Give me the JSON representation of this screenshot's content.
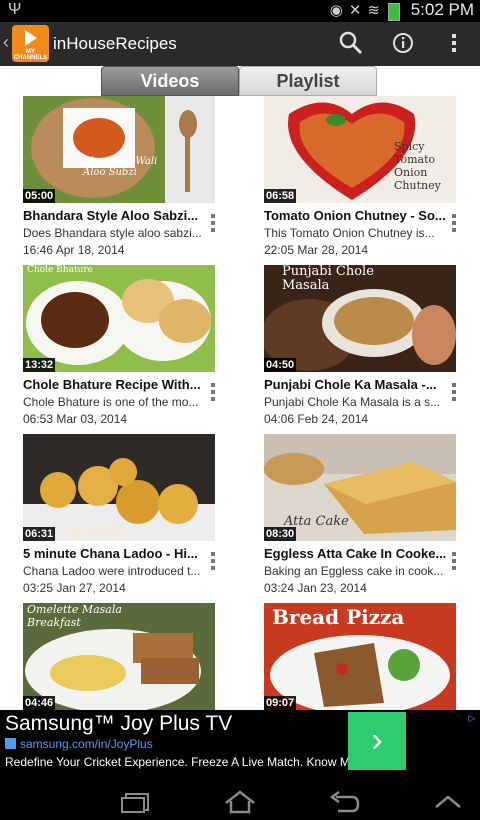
{
  "status_bar": {
    "time": "5:02 PM"
  },
  "app": {
    "title": "inHouseRecipes",
    "logo_label": "MY CHANNELS"
  },
  "tabs": [
    {
      "label": "Videos",
      "active": true
    },
    {
      "label": "Playlist",
      "active": false
    }
  ],
  "icons": {
    "search": "search-icon",
    "info": "info-icon",
    "overflow": "overflow-menu-icon",
    "back": "back-icon",
    "home": "home-icon",
    "recent": "recent-apps-icon",
    "up": "chevron-up-icon"
  },
  "videos": [
    {
      "title": "Bhandara Style Aloo Sabzi...",
      "description": "Does Bhandara style aloo sabzi...",
      "date": "16:46 Apr 18, 2014",
      "duration": "05:00",
      "thumb_caption": "Bhandara Wali Aloo Subzi"
    },
    {
      "title": "Tomato Onion Chutney - So...",
      "description": "This Tomato Onion Chutney is...",
      "date": "22:05 Mar 28, 2014",
      "duration": "06:58",
      "thumb_caption": "Spicy Tomato Onion Chutney"
    },
    {
      "title": "Chole Bhature Recipe With...",
      "description": "Chole Bhature is one of the mo...",
      "date": "06:53 Mar 03, 2014",
      "duration": "13:32",
      "thumb_caption": "Chole Bhature"
    },
    {
      "title": "Punjabi Chole Ka Masala -...",
      "description": "Punjabi Chole Ka Masala is a s...",
      "date": "04:06 Feb 24, 2014",
      "duration": "04:50",
      "thumb_caption": "Punjabi Chole Masala"
    },
    {
      "title": "5 minute Chana Ladoo - Hi...",
      "description": "Chana Ladoo were introduced t...",
      "date": "03:25 Jan 27, 2014",
      "duration": "06:31",
      "thumb_caption": "na Ladoo"
    },
    {
      "title": "Eggless Atta Cake In Cooke...",
      "description": "Baking an Eggless cake in cook...",
      "date": "03:24 Jan 23, 2014",
      "duration": "08:30",
      "thumb_caption": "Atta Cake"
    },
    {
      "title": "",
      "description": "",
      "date": "",
      "duration": "04:46",
      "thumb_caption": "Omelette Masala Breakfast"
    },
    {
      "title": "",
      "description": "",
      "date": "",
      "duration": "09:07",
      "thumb_caption": "Bread Pizza"
    }
  ],
  "ad": {
    "title": "Samsung™ Joy Plus TV",
    "url": "samsung.com/in/JoyPlus",
    "text": "Redefine Your Cricket Experience. Freeze A Live Match. Know More!",
    "cta": "›",
    "choices": "▷",
    "button_color": "#2ecc71"
  },
  "colors": {
    "logo": "#f28a1b",
    "actionbar": "#2a2a2a",
    "link": "#4d9ef0"
  }
}
